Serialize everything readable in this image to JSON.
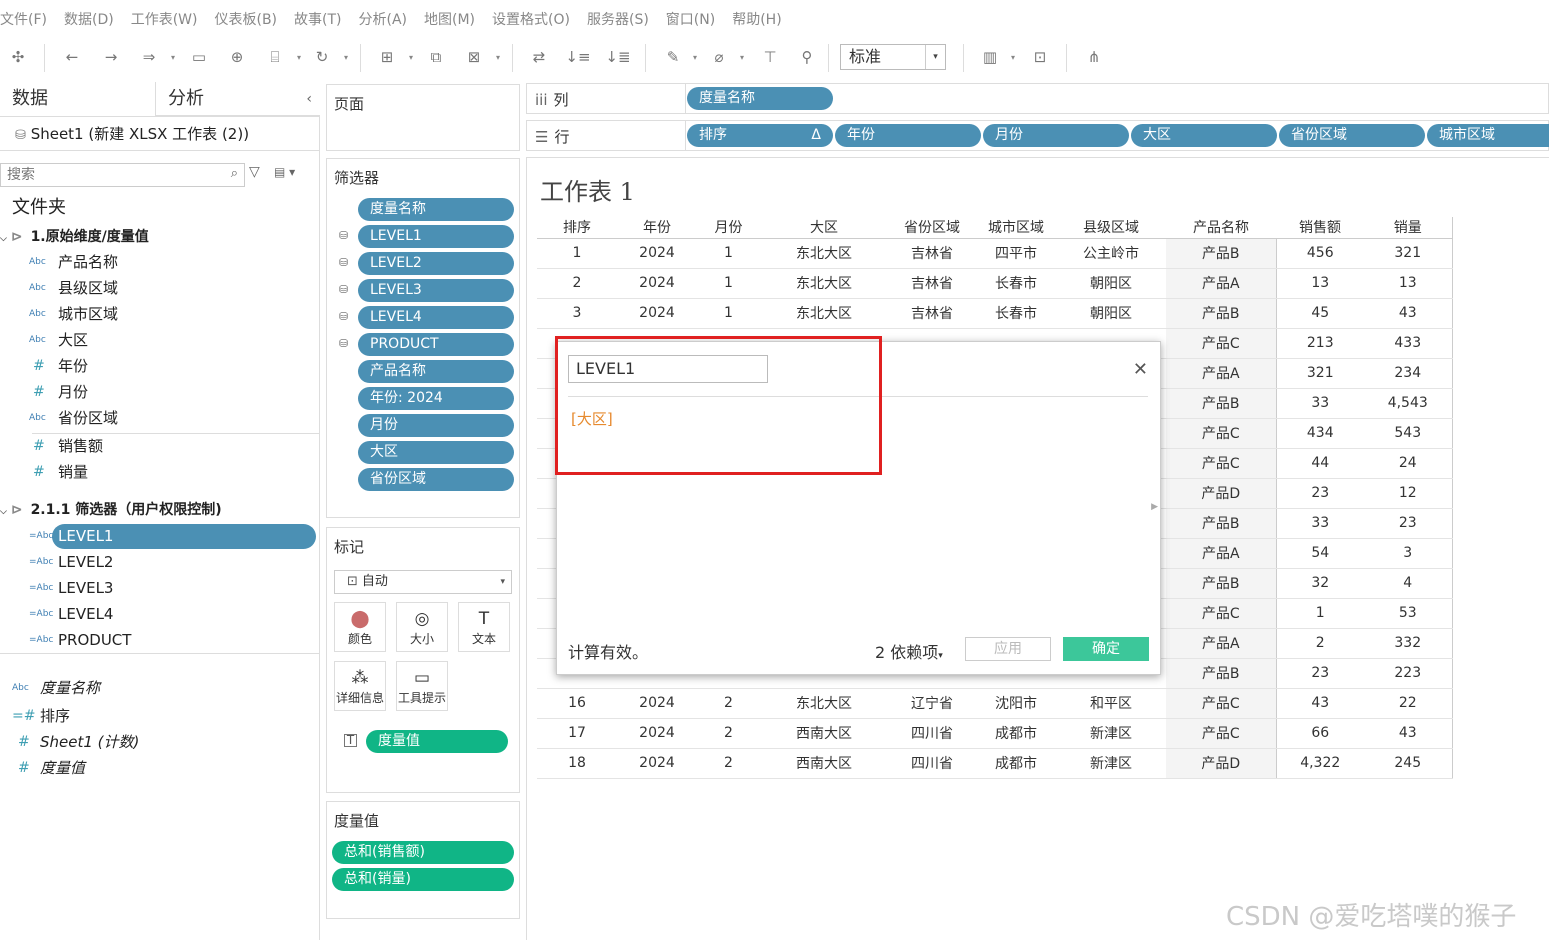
{
  "menu": [
    "文件(F)",
    "数据(D)",
    "工作表(W)",
    "仪表板(B)",
    "故事(T)",
    "分析(A)",
    "地图(M)",
    "设置格式(O)",
    "服务器(S)",
    "窗口(N)",
    "帮助(H)"
  ],
  "toolbar": {
    "fit_label": "标准"
  },
  "data_pane": {
    "tab_data": "数据",
    "tab_analysis": "分析",
    "datasource": "Sheet1 (新建 XLSX 工作表 (2))",
    "search_placeholder": "搜索",
    "folders_label": "文件夹",
    "folder1": "1.原始维度/度量值",
    "folder1_fields": [
      {
        "type": "Abc",
        "name": "产品名称"
      },
      {
        "type": "Abc",
        "name": "县级区域"
      },
      {
        "type": "Abc",
        "name": "城市区域"
      },
      {
        "type": "Abc",
        "name": "大区"
      },
      {
        "type": "#",
        "name": "年份"
      },
      {
        "type": "#",
        "name": "月份"
      },
      {
        "type": "Abc",
        "name": "省份区域"
      },
      {
        "type": "#",
        "name": "销售额"
      },
      {
        "type": "#",
        "name": "销量"
      }
    ],
    "folder2": "2.1.1 筛选器（用户权限控制)",
    "folder2_fields": [
      {
        "type": "=Abc",
        "name": "LEVEL1"
      },
      {
        "type": "=Abc",
        "name": "LEVEL2"
      },
      {
        "type": "=Abc",
        "name": "LEVEL3"
      },
      {
        "type": "=Abc",
        "name": "LEVEL4"
      },
      {
        "type": "=Abc",
        "name": "PRODUCT"
      }
    ],
    "extra_fields": [
      {
        "type": "Abc",
        "name": "度量名称"
      },
      {
        "type": "=#",
        "name": "排序"
      },
      {
        "type": "#",
        "name": "Sheet1 (计数)"
      },
      {
        "type": "#",
        "name": "度量值"
      }
    ]
  },
  "pages_label": "页面",
  "filters": {
    "label": "筛选器",
    "items": [
      "度量名称",
      "LEVEL1",
      "LEVEL2",
      "LEVEL3",
      "LEVEL4",
      "PRODUCT",
      "产品名称",
      "年份: 2024",
      "月份",
      "大区",
      "省份区域"
    ]
  },
  "marks": {
    "label": "标记",
    "type": "自动",
    "buttons": [
      {
        "icon": "color-icon",
        "label": "颜色"
      },
      {
        "icon": "size-icon",
        "label": "大小"
      },
      {
        "icon": "text-icon",
        "label": "文本"
      },
      {
        "icon": "detail-icon",
        "label": "详细信息"
      },
      {
        "icon": "tooltip-icon",
        "label": "工具提示"
      }
    ],
    "field": "度量值"
  },
  "measure_values": {
    "label": "度量值",
    "items": [
      "总和(销售额)",
      "总和(销量)"
    ]
  },
  "columns_shelf": {
    "label": "列",
    "pills": [
      "度量名称"
    ]
  },
  "rows_shelf": {
    "label": "行",
    "pills": [
      "排序",
      "年份",
      "月份",
      "大区",
      "省份区域",
      "城市区域"
    ]
  },
  "sheet": {
    "title": "工作表 1",
    "headers": [
      "排序",
      "年份",
      "月份",
      "大区",
      "省份区域",
      "城市区域",
      "县级区域",
      "产品名称",
      "销售额",
      "销量"
    ],
    "rows": [
      [
        "1",
        "2024",
        "1",
        "东北大区",
        "吉林省",
        "四平市",
        "公主岭市",
        "产品B",
        "456",
        "321"
      ],
      [
        "2",
        "2024",
        "1",
        "东北大区",
        "吉林省",
        "长春市",
        "朝阳区",
        "产品A",
        "13",
        "13"
      ],
      [
        "3",
        "2024",
        "1",
        "东北大区",
        "吉林省",
        "长春市",
        "朝阳区",
        "产品B",
        "45",
        "43"
      ],
      [
        "",
        "",
        "",
        "",
        "",
        "",
        "",
        "产品C",
        "213",
        "433"
      ],
      [
        "",
        "",
        "",
        "",
        "",
        "",
        "",
        "产品A",
        "321",
        "234"
      ],
      [
        "",
        "",
        "",
        "",
        "",
        "",
        "",
        "产品B",
        "33",
        "4,543"
      ],
      [
        "",
        "",
        "",
        "",
        "",
        "",
        "",
        "产品C",
        "434",
        "543"
      ],
      [
        "",
        "",
        "",
        "",
        "",
        "",
        "",
        "产品C",
        "44",
        "24"
      ],
      [
        "",
        "",
        "",
        "",
        "",
        "",
        "",
        "产品D",
        "23",
        "12"
      ],
      [
        "",
        "",
        "",
        "",
        "",
        "",
        "",
        "产品B",
        "33",
        "23"
      ],
      [
        "",
        "",
        "",
        "",
        "",
        "",
        "",
        "产品A",
        "54",
        "3"
      ],
      [
        "",
        "",
        "",
        "",
        "",
        "",
        "",
        "产品B",
        "32",
        "4"
      ],
      [
        "",
        "",
        "",
        "",
        "",
        "",
        "",
        "产品C",
        "1",
        "53"
      ],
      [
        "",
        "",
        "",
        "",
        "",
        "",
        "",
        "产品A",
        "2",
        "332"
      ],
      [
        "",
        "",
        "",
        "",
        "",
        "",
        "",
        "产品B",
        "23",
        "223"
      ],
      [
        "16",
        "2024",
        "2",
        "东北大区",
        "辽宁省",
        "沈阳市",
        "和平区",
        "产品C",
        "43",
        "22"
      ],
      [
        "17",
        "2024",
        "2",
        "西南大区",
        "四川省",
        "成都市",
        "新津区",
        "产品C",
        "66",
        "43"
      ],
      [
        "18",
        "2024",
        "2",
        "西南大区",
        "四川省",
        "成都市",
        "新津区",
        "产品D",
        "4,322",
        "245"
      ]
    ]
  },
  "dialog": {
    "name": "LEVEL1",
    "formula": "[大区]",
    "status": "计算有效。",
    "dependencies": "2 依赖项",
    "apply": "应用",
    "ok": "确定"
  },
  "watermark": "CSDN @爱吃塔噗的猴子"
}
